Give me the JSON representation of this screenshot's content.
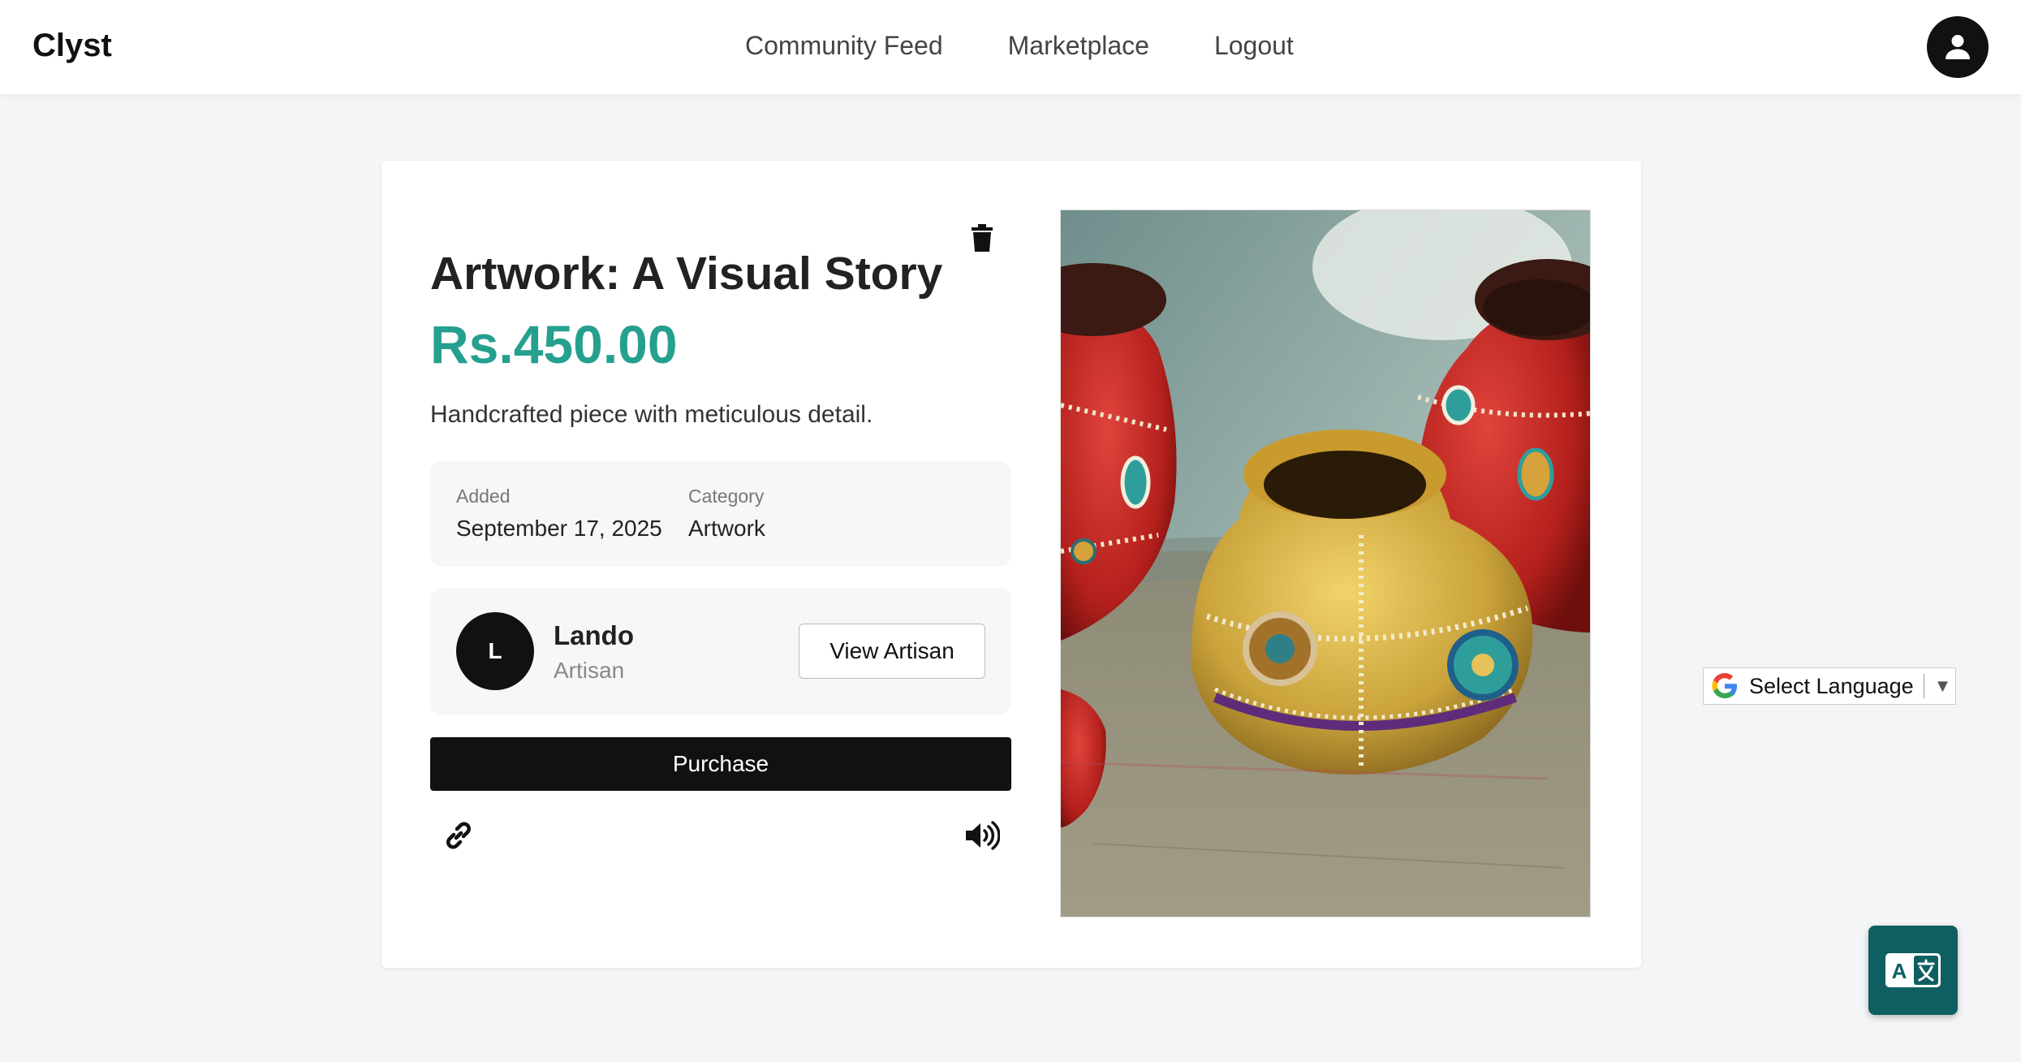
{
  "nav": {
    "brand": "Clyst",
    "links": [
      "Community Feed",
      "Marketplace",
      "Logout"
    ],
    "user_icon": "user-circle-icon"
  },
  "product": {
    "title": "Artwork: A Visual Story",
    "price": "Rs.450.00",
    "description": "Handcrafted piece with meticulous detail.",
    "added_label": "Added",
    "added_value": "September 17, 2025",
    "category_label": "Category",
    "category_value": "Artwork",
    "delete_icon": "trash-icon",
    "image_alt": "decorated clay pots"
  },
  "artisan": {
    "initial": "L",
    "name": "Lando",
    "role": "Artisan",
    "view_label": "View Artisan"
  },
  "actions": {
    "purchase_label": "Purchase",
    "share_icon": "link-icon",
    "speak_icon": "speaker-icon"
  },
  "language": {
    "select_label": "Select Language",
    "arrow": "▼"
  },
  "colors": {
    "accent": "#26a08e",
    "fab": "#0f5f62",
    "dark": "#111111"
  }
}
